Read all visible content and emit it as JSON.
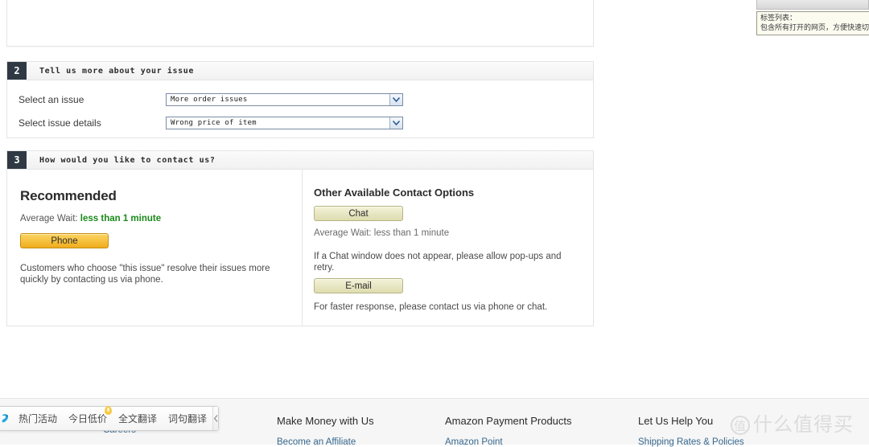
{
  "section1": {
    "textarea_value": ""
  },
  "section2": {
    "number": "2",
    "title": "Tell us more about your issue",
    "rows": [
      {
        "label": "Select an issue",
        "value": "More order issues",
        "icon": "chevron-down-icon"
      },
      {
        "label": "Select issue details",
        "value": "Wrong price of item",
        "icon": "chevron-down-icon"
      }
    ]
  },
  "section3": {
    "number": "3",
    "title": "How would you like to contact us?",
    "recommended": {
      "heading": "Recommended",
      "wait_label": "Average Wait:",
      "wait_value": "less than 1 minute",
      "button_label": "Phone",
      "note": "Customers who choose \"this issue\" resolve their issues more quickly by contacting us via phone."
    },
    "other": {
      "heading": "Other Available Contact Options",
      "chat_button_label": "Chat",
      "chat_wait": "Average Wait: less than 1 minute",
      "chat_note": "If a Chat window does not appear, please allow pop-ups and retry.",
      "email_button_label": "E-mail",
      "email_note": "For faster response, please contact us via phone or chat."
    }
  },
  "footer": {
    "columns": [
      {
        "heading": "",
        "link": "Careers"
      },
      {
        "heading": "Make Money with Us",
        "link": "Become an Affiliate"
      },
      {
        "heading": "Amazon Payment Products",
        "link": "Amazon Point"
      },
      {
        "heading": "Let Us Help You",
        "link": "Shipping Rates & Policies"
      }
    ]
  },
  "cn_toolbar": {
    "logo_icon": "browser-assistant-icon",
    "items": [
      {
        "label": "热门活动",
        "badge": false
      },
      {
        "label": "今日低价",
        "badge": true
      },
      {
        "label": "全文翻译",
        "badge": false
      },
      {
        "label": "词句翻译",
        "badge": false
      }
    ],
    "collapse_icon": "chevron-left-icon"
  },
  "tooltip": {
    "line1": "标签列表：",
    "line2": "包含所有打开的网页，方便快速切"
  },
  "watermark": {
    "mark": "值",
    "text": "什么值得买"
  },
  "colors": {
    "accent_orange": "#f0ad1c",
    "pale_button": "#dedcaf",
    "wait_green": "#1a8a1a",
    "section_badge": "#2f3944",
    "link_blue": "#36688e"
  }
}
